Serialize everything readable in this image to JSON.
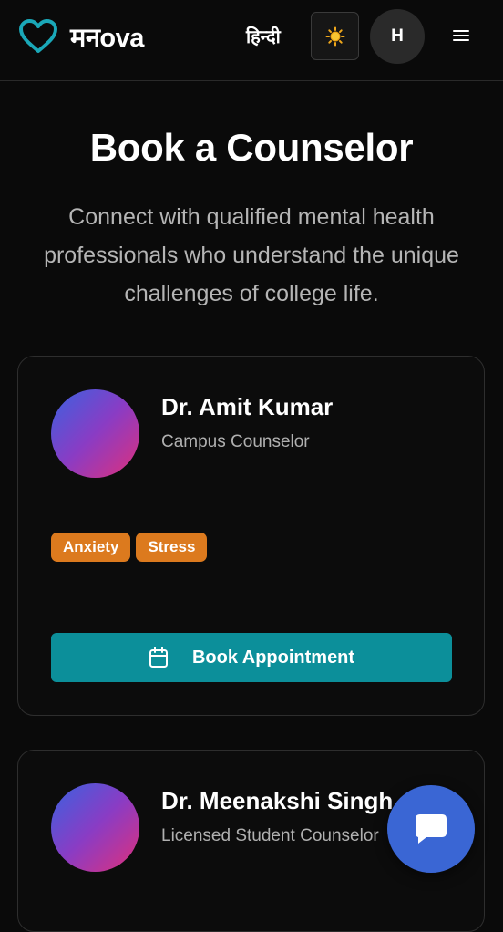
{
  "header": {
    "logo_icon": "heart-icon",
    "logo_text": "मनova",
    "language_label": "हिन्दी",
    "theme_icon": "sun-icon",
    "avatar_initial": "H",
    "menu_icon": "hamburger-menu-icon"
  },
  "page": {
    "title": "Book a Counselor",
    "subtitle": "Connect with qualified mental health professionals who understand the unique challenges of college life."
  },
  "counselors": [
    {
      "name": "Dr. Amit Kumar",
      "role": "Campus Counselor",
      "tags": [
        "Anxiety",
        "Stress"
      ],
      "button_label": "Book Appointment",
      "button_icon": "calendar-icon"
    },
    {
      "name": "Dr. Meenakshi Singh",
      "role": "Licensed Student Counselor"
    }
  ],
  "chat": {
    "icon": "chat-bubble-icon"
  },
  "colors": {
    "accent_teal": "#0c8f9a",
    "tag_orange": "#dc7a1e",
    "chat_blue": "#3a66d4",
    "logo_cyan": "#1aa8b8",
    "background": "#0a0a0a"
  }
}
